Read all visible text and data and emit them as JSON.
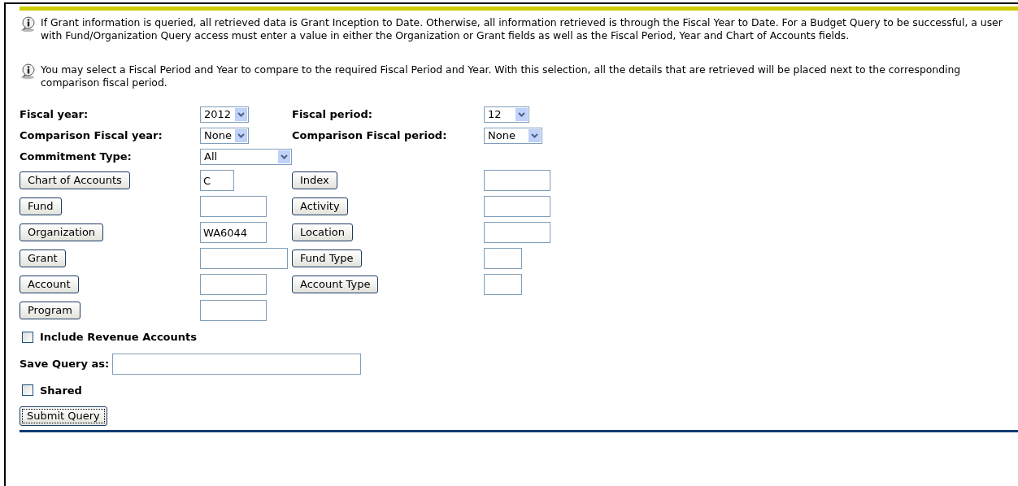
{
  "info_notes": [
    "If Grant information is queried, all retrieved data is Grant Inception to Date. Otherwise, all information retrieved is through the Fiscal Year to Date. For a Budget Query to be successful, a user with Fund/Organization Query access must enter a value in either the Organization or Grant fields as well as the Fiscal Period, Year and Chart of Accounts fields.",
    "You may select a Fiscal Period and Year to compare to the required Fiscal Period and Year. With this selection, all the details that are retrieved will be placed next to the corresponding comparison fiscal period."
  ],
  "rows": [
    [
      {
        "kind": "select",
        "label": "Fiscal year:",
        "value": "2012"
      },
      {
        "kind": "select",
        "label": "Fiscal period:",
        "value": "12"
      }
    ],
    [
      {
        "kind": "select",
        "label": "Comparison Fiscal year:",
        "value": "None"
      },
      {
        "kind": "select",
        "label": "Comparison Fiscal period:",
        "value": "None"
      }
    ],
    [
      {
        "kind": "select",
        "label": "Commitment Type:",
        "value": "All"
      }
    ],
    [
      {
        "kind": "lookup",
        "label": "Chart of Accounts",
        "value": "C"
      },
      {
        "kind": "lookup",
        "label": "Index"
      }
    ],
    [
      {
        "kind": "lookup",
        "label": "Fund"
      },
      {
        "kind": "lookup",
        "label": "Activity"
      }
    ],
    [
      {
        "kind": "lookup",
        "label": "Organization",
        "value": "WA6044"
      },
      {
        "kind": "lookup",
        "label": "Location"
      }
    ],
    [
      {
        "kind": "lookup",
        "label": "Grant"
      },
      {
        "kind": "lookup",
        "label": "Fund Type"
      }
    ],
    [
      {
        "kind": "lookup",
        "label": "Account"
      },
      {
        "kind": "lookup",
        "label": "Account Type"
      }
    ],
    [
      {
        "kind": "lookup",
        "label": "Program"
      }
    ]
  ],
  "include_revenue": {
    "label": "Include Revenue Accounts",
    "checked": false
  },
  "save_query": {
    "label": "Save Query as:"
  },
  "shared": {
    "label": "Shared",
    "checked": false
  },
  "submit_button": "Submit Query"
}
